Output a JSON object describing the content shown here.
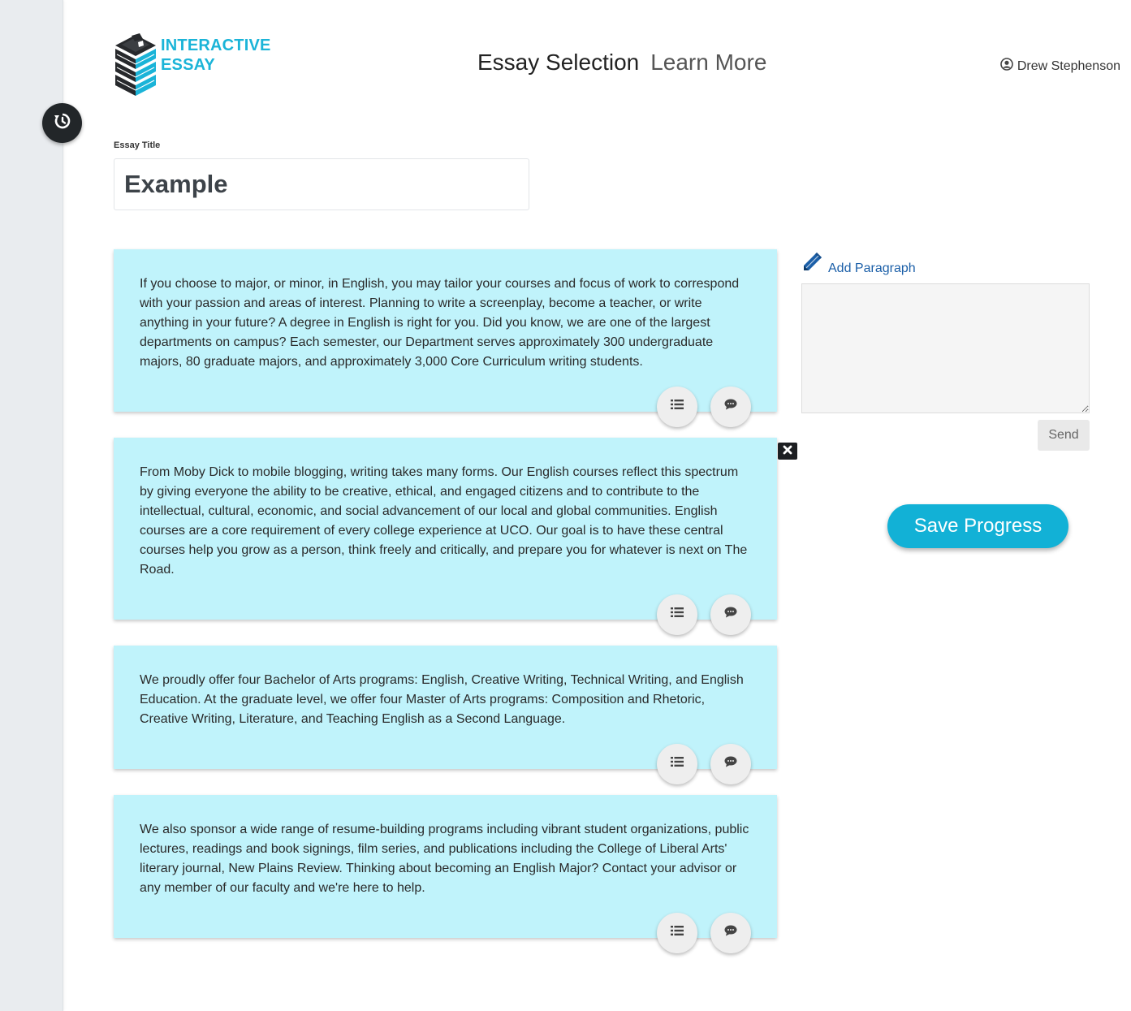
{
  "brand": {
    "line1": "INTERACTIVE",
    "line2": "ESSAY",
    "accent_color": "#1bb4d8"
  },
  "nav": {
    "essay_selection": "Essay Selection",
    "learn_more": "Learn More"
  },
  "user": {
    "name": "Drew Stephenson",
    "icon": "user-circle-icon"
  },
  "sidebar": {
    "history_icon": "history-icon"
  },
  "essay": {
    "title_label": "Essay Title",
    "title_value": "Example"
  },
  "paragraphs": [
    {
      "text": "If you choose to major, or minor, in English, you may tailor your courses and focus of work to correspond with your passion and areas of interest. Planning to write a screenplay, become a teacher, or write anything in your future? A degree in English is right for you. Did you know, we are one of the largest departments on campus? Each semester, our Department serves approximately 300 undergraduate majors, 80 graduate majors, and approximately 3,000 Core Curriculum writing students."
    },
    {
      "text": "From Moby Dick to mobile blogging, writing takes many forms. Our English courses reflect this spectrum by giving everyone the ability to be creative, ethical, and engaged citizens and to contribute to the intellectual, cultural, economic, and social advancement of our local and global communities. English courses are a core requirement of every college experience at UCO. Our goal is to have these central courses help you grow as a person, think freely and critically, and prepare you for whatever is next on The Road."
    },
    {
      "text": "We proudly offer four Bachelor of Arts programs: English, Creative Writing, Technical Writing, and English Education. At the graduate level, we offer four Master of Arts programs: Composition and Rhetoric, Creative Writing, Literature, and Teaching English as a Second Language."
    },
    {
      "text": "We also sponsor a wide range of resume-building programs including vibrant student organizations, public lectures, readings and book signings, film series, and publications including the College of Liberal Arts' literary journal, New Plains Review. Thinking about becoming an English Major? Contact your advisor or any member of our faculty and we're here to help."
    }
  ],
  "add_paragraph": {
    "label": "Add Paragraph",
    "textarea_value": "",
    "send_label": "Send"
  },
  "save": {
    "label": "Save Progress",
    "color": "#12b1d6"
  },
  "colors": {
    "card_background": "#c0f3fb",
    "sidebar": "#e9ecef"
  }
}
